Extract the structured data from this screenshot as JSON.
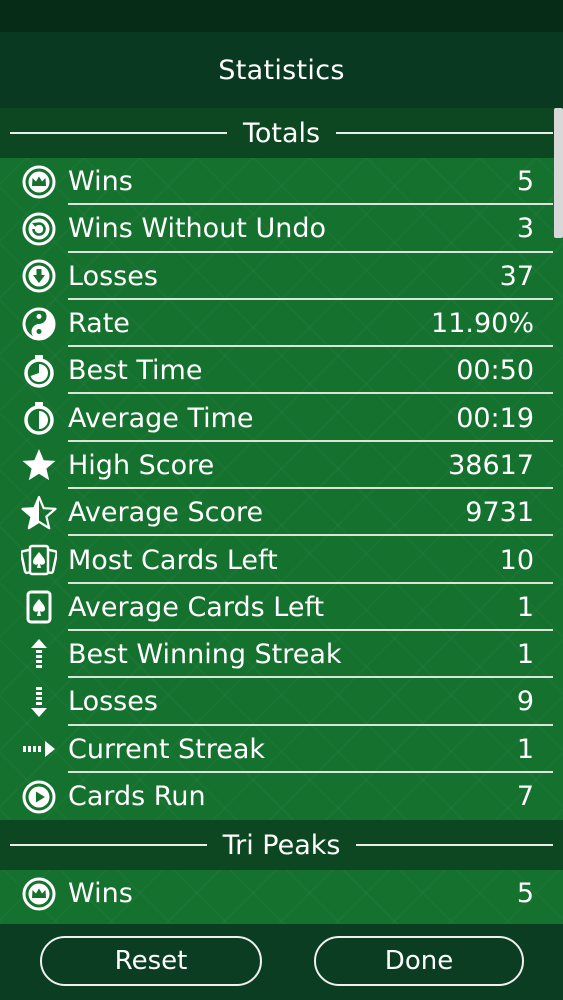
{
  "header": {
    "title": "Statistics"
  },
  "totals": {
    "title": "Totals",
    "rows": [
      {
        "label": "Wins",
        "value": "5",
        "icon": "crown-circle-icon"
      },
      {
        "label": "Wins Without Undo",
        "value": "3",
        "icon": "no-undo-icon"
      },
      {
        "label": "Losses",
        "value": "37",
        "icon": "down-arrow-circle-icon"
      },
      {
        "label": "Rate",
        "value": "11.90%",
        "icon": "yin-yang-icon"
      },
      {
        "label": "Best Time",
        "value": "00:50",
        "icon": "stopwatch-icon"
      },
      {
        "label": "Average Time",
        "value": "00:19",
        "icon": "stopwatch-half-icon"
      },
      {
        "label": "High Score",
        "value": "38617",
        "icon": "star-icon"
      },
      {
        "label": "Average Score",
        "value": "9731",
        "icon": "half-star-icon"
      },
      {
        "label": "Most Cards Left",
        "value": "10",
        "icon": "cards-fan-icon"
      },
      {
        "label": "Average Cards Left",
        "value": "1",
        "icon": "card-spade-icon"
      },
      {
        "label": "Best Winning Streak",
        "value": "1",
        "icon": "dashed-up-arrow-icon"
      },
      {
        "label": "Losses",
        "value": "9",
        "icon": "dashed-down-arrow-icon"
      },
      {
        "label": "Current Streak",
        "value": "1",
        "icon": "dashed-right-arrow-icon"
      },
      {
        "label": "Cards Run",
        "value": "7",
        "icon": "play-circle-icon"
      }
    ]
  },
  "tri_peaks": {
    "title": "Tri Peaks",
    "rows": [
      {
        "label": "Wins",
        "value": "5",
        "icon": "crown-circle-icon"
      }
    ]
  },
  "footer": {
    "reset_label": "Reset",
    "done_label": "Done"
  }
}
